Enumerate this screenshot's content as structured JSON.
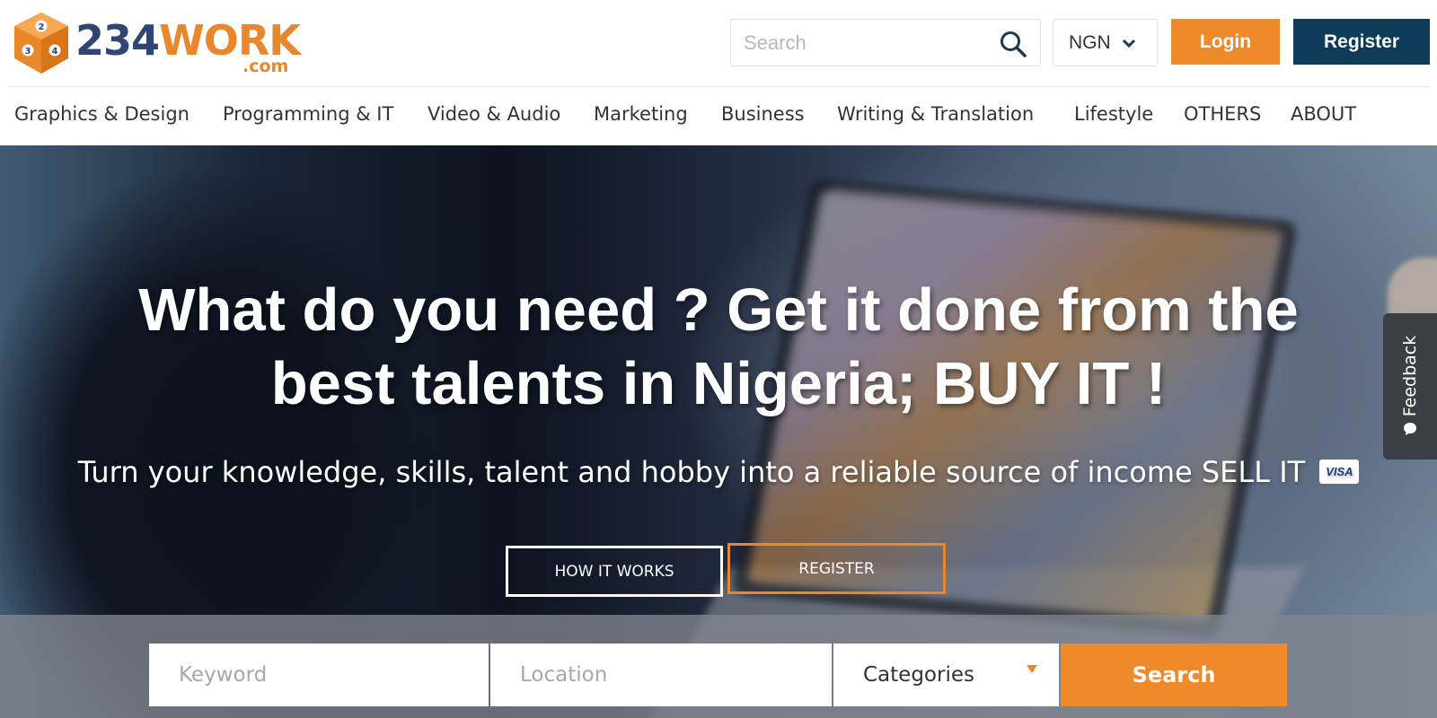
{
  "brand": {
    "logo_number": "234",
    "logo_word": "WORK",
    "logo_suffix": ".com",
    "dice_digits": [
      "2",
      "3",
      "4"
    ],
    "colors": {
      "orange": "#ef8a2b",
      "navy": "#0e3c58",
      "logo_blue": "#2f4574"
    }
  },
  "header": {
    "search_placeholder": "Search",
    "search_icon": "search-icon",
    "currency": "NGN",
    "login_label": "Login",
    "register_label": "Register"
  },
  "nav": {
    "items": [
      {
        "label": "Graphics & Design"
      },
      {
        "label": "Programming & IT"
      },
      {
        "label": "Video & Audio"
      },
      {
        "label": "Marketing"
      },
      {
        "label": "Business"
      },
      {
        "label": "Writing & Translation"
      },
      {
        "label": "Lifestyle"
      },
      {
        "label": "OTHERS"
      },
      {
        "label": "ABOUT"
      }
    ]
  },
  "hero": {
    "title_line1": "What do you need ? Get it done from the",
    "title_line2": "best talents in Nigeria; BUY IT !",
    "subtitle": "Turn your knowledge, skills, talent and hobby into a reliable source of income SELL IT",
    "card_badge": "VISA",
    "how_label": "HOW IT WORKS",
    "register_label": "REGISTER"
  },
  "search_bar": {
    "keyword_placeholder": "Keyword",
    "location_placeholder": "Location",
    "category_selected": "Categories",
    "submit_label": "Search"
  },
  "feedback": {
    "label": "Feedback"
  }
}
